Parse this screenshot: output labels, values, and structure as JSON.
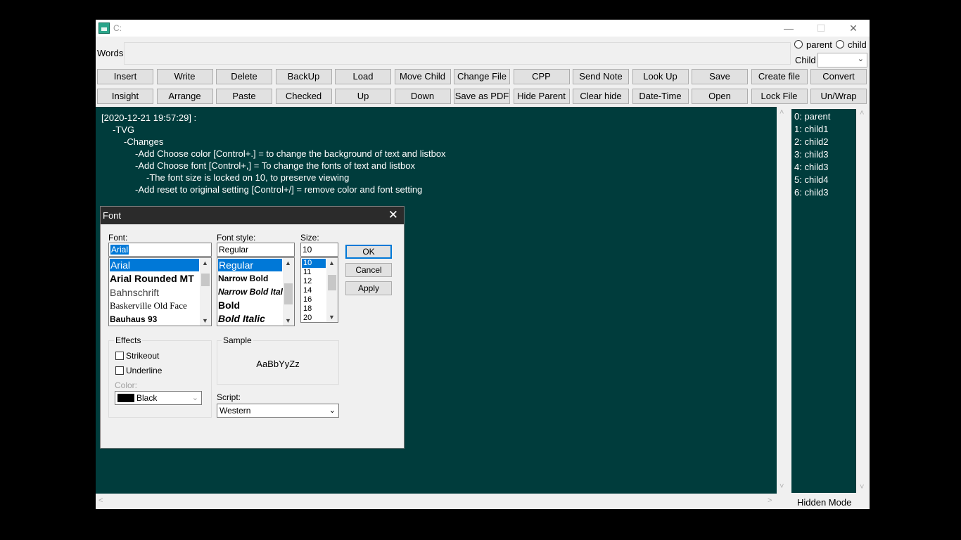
{
  "window": {
    "title": "C:",
    "controls": {
      "minimize": "—",
      "maximize": "☐",
      "close": "✕"
    }
  },
  "words": {
    "label": "Words",
    "value": ""
  },
  "radios": {
    "parent": "parent",
    "child": "child"
  },
  "child_select": {
    "label": "Child",
    "value": ""
  },
  "toolbar_row1": [
    "Insert",
    "Write",
    "Delete",
    "BackUp",
    "Load",
    "Move Child",
    "Change File",
    "CPP",
    "Send Note",
    "Look Up",
    "Save",
    "Create file",
    "Convert"
  ],
  "toolbar_row2": [
    "Insight",
    "Arrange",
    "Paste",
    "Checked",
    "Up",
    "Down",
    "Save as PDF",
    "Hide Parent",
    "Clear hide",
    "Date-Time",
    "Open",
    "Lock File",
    "Un/Wrap"
  ],
  "editor": {
    "lines": [
      "[2020-12-21 19:57:29] :",
      "-TVG",
      "-Changes",
      "-Add Choose color [Control+.] = to change the background of text and listbox",
      "-Add Choose font [Control+,] = To change the fonts of text and listbox",
      "-The font size is locked on 10, to preserve viewing",
      "-Add reset to original setting [Control+/] = remove color and font setting"
    ],
    "background": "#003c3c"
  },
  "listbox": {
    "items": [
      "0: parent",
      "1: child1",
      "2: child2",
      "3: child3",
      "4: child3",
      "5: child4",
      "6: child3"
    ]
  },
  "status": {
    "hidden_mode": "Hidden Mode"
  },
  "font_dialog": {
    "title": "Font",
    "font_label": "Font:",
    "font_value": "Arial",
    "fonts": [
      "Arial",
      "Arial Rounded MT",
      "Bahnschrift",
      "Baskerville Old Face",
      "Bauhaus 93"
    ],
    "style_label": "Font style:",
    "style_value": "Regular",
    "styles": [
      "Regular",
      "Narrow Bold",
      "Narrow Bold Italic",
      "Bold",
      "Bold Italic"
    ],
    "size_label": "Size:",
    "size_value": "10",
    "sizes": [
      "10",
      "11",
      "12",
      "14",
      "16",
      "18",
      "20"
    ],
    "ok": "OK",
    "cancel": "Cancel",
    "apply": "Apply",
    "effects_label": "Effects",
    "strikeout": "Strikeout",
    "underline": "Underline",
    "color_label": "Color:",
    "color_value": "Black",
    "sample_label": "Sample",
    "sample_text": "AaBbYyZz",
    "script_label": "Script:",
    "script_value": "Western"
  }
}
